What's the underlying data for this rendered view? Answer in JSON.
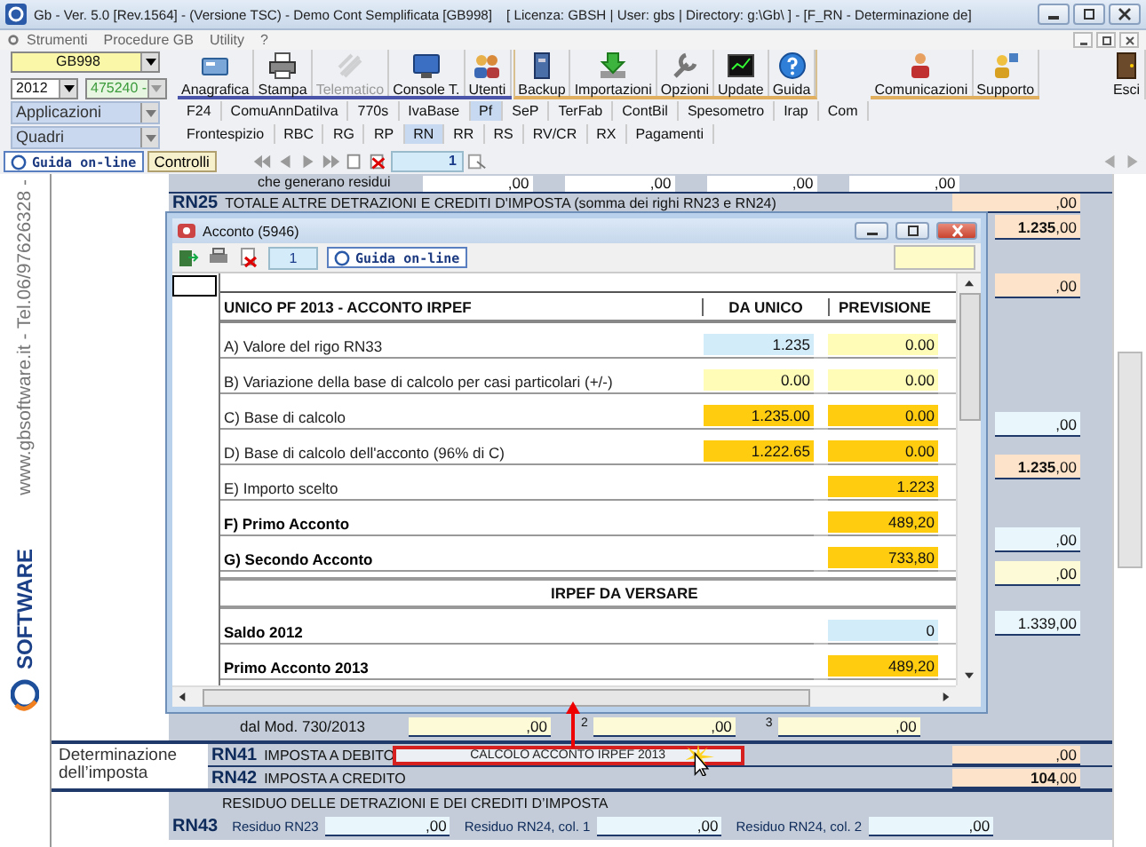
{
  "window": {
    "title": "Gb - Ver. 5.0 [Rev.1564] - (Versione TSC) -  Demo Cont Semplificata [GB998]",
    "info": "[ Licenza: GBSH | User: gbs | Directory: g:\\Gb\\ ] - [F_RN - Determinazione de]"
  },
  "menu": [
    "Strumenti",
    "Procedure GB",
    "Utility",
    "?"
  ],
  "selectors": {
    "company": "GB998",
    "year": "2012",
    "code": "475240 -",
    "applications": "Applicazioni",
    "sections": "Quadri"
  },
  "toolbar_main": [
    {
      "label": "Anagrafica",
      "disabled": false
    },
    {
      "label": "Stampa",
      "disabled": false
    },
    {
      "label": "Telematico",
      "disabled": true
    },
    {
      "label": "Console T.",
      "disabled": false
    },
    {
      "label": "Utenti",
      "disabled": false
    }
  ],
  "toolbar_tools": [
    {
      "label": "Backup"
    },
    {
      "label": "Importazioni"
    },
    {
      "label": "Opzioni"
    },
    {
      "label": "Update"
    },
    {
      "label": "Guida"
    }
  ],
  "toolbar_extra": [
    {
      "label": "Comunicazioni"
    },
    {
      "label": "Supporto"
    }
  ],
  "exit": "Esci",
  "app_tabs": [
    {
      "label": "F24",
      "selected": false
    },
    {
      "label": "ComuAnnDatiIva",
      "selected": false
    },
    {
      "label": "770s",
      "selected": false
    },
    {
      "label": "IvaBase",
      "selected": false
    },
    {
      "label": "Pf",
      "selected": true
    },
    {
      "label": "SeP",
      "selected": false
    },
    {
      "label": "TerFab",
      "selected": false
    },
    {
      "label": "ContBil",
      "selected": false
    },
    {
      "label": "Spesometro",
      "selected": false
    },
    {
      "label": "Irap",
      "selected": false
    },
    {
      "label": "Com",
      "selected": false
    }
  ],
  "quadro_tabs": [
    {
      "label": "Frontespizio",
      "selected": false
    },
    {
      "label": "RBC",
      "selected": false
    },
    {
      "label": "RG",
      "selected": false
    },
    {
      "label": "RP",
      "selected": false
    },
    {
      "label": "RN",
      "selected": true
    },
    {
      "label": "RR",
      "selected": false
    },
    {
      "label": "RS",
      "selected": false
    },
    {
      "label": "RV/CR",
      "selected": false
    },
    {
      "label": "RX",
      "selected": false
    },
    {
      "label": "Pagamenti",
      "selected": false
    }
  ],
  "nav": {
    "help": "Guida on-line",
    "checks": "Controlli",
    "page": "1"
  },
  "sidebar": {
    "contact": "www.gbsoftware.it - Tel.06/97626328 -",
    "logo": "SOFTWARE"
  },
  "form": {
    "residui_row": {
      "label": "che generano residui",
      "fields": [
        ",00",
        ",00",
        ",00",
        ",00"
      ]
    },
    "rn25": {
      "code": "RN25",
      "label": "TOTALE ALTRE DETRAZIONI E CREDITI D'IMPOSTA (somma dei righi RN23 e RN24)",
      "value": ",00"
    },
    "right_values": [
      {
        "value": "**1.235**,00",
        "kind": "calc"
      },
      {
        "value": ",00",
        "kind": "calc"
      },
      {
        "value": ",00",
        "kind": "input"
      },
      {
        "value": "**1.235**,00",
        "kind": "calc"
      },
      {
        "value": ",00",
        "kind": "input"
      },
      {
        "value": ",00",
        "kind": "manual"
      },
      {
        "value": "1.339,00",
        "kind": "input"
      }
    ],
    "rn40": {
      "label": "dal Mod. 730/2013",
      "fields": [
        {
          "value": ",00"
        },
        {
          "tag": "2",
          "value": ",00"
        },
        {
          "tag": "3",
          "value": ",00"
        }
      ]
    },
    "section_label": "Determinazione dell’imposta",
    "rn41": {
      "code": "RN41",
      "label": "IMPOSTA A DEBITO",
      "action": "CALCOLO ACCONTO IRPEF  2013",
      "value": ",00"
    },
    "rn42": {
      "code": "RN42",
      "label": "IMPOSTA A CREDITO",
      "value": "**104**,00"
    },
    "residuo_title": "RESIDUO DELLE DETRAZIONI E DEI CREDITI D’IMPOSTA",
    "rn43": {
      "code": "RN43",
      "fields": [
        {
          "label": "Residuo RN23",
          "value": ",00"
        },
        {
          "label": "Residuo RN24, col. 1",
          "value": ",00"
        },
        {
          "label": "Residuo RN24, col. 2",
          "value": ",00"
        }
      ]
    }
  },
  "dialog": {
    "title": "Acconto (5946)",
    "page": "1",
    "help": "Guida on-line",
    "header": [
      "UNICO PF 2013 - ACCONTO IRPEF",
      "DA UNICO",
      "PREVISIONE"
    ],
    "rows": [
      {
        "kind": "pair",
        "label": "A) Valore del rigo RN33",
        "bold": false,
        "unico": {
          "value": "1.235",
          "kind": "input"
        },
        "previsione": {
          "value": "0.00",
          "kind": "manual"
        }
      },
      {
        "kind": "pair",
        "label": "B) Variazione della base di calcolo per casi particolari (+/-)",
        "bold": false,
        "unico": {
          "value": "0.00",
          "kind": "manual"
        },
        "previsione": {
          "value": "0.00",
          "kind": "manual"
        }
      },
      {
        "kind": "pair",
        "label": "C) Base di calcolo",
        "bold": false,
        "unico": {
          "value": "1.235.00",
          "kind": "calc"
        },
        "previsione": {
          "value": "0.00",
          "kind": "calc"
        }
      },
      {
        "kind": "pair",
        "label": "D) Base di calcolo dell'acconto (96% di C)",
        "bold": false,
        "unico": {
          "value": "1.222.65",
          "kind": "calc"
        },
        "previsione": {
          "value": "0.00",
          "kind": "calc"
        }
      },
      {
        "kind": "single",
        "label": "E) Importo scelto",
        "bold": false,
        "previsione": {
          "value": "1.223",
          "kind": "calc"
        }
      },
      {
        "kind": "single",
        "label": "F) Primo Acconto",
        "bold": true,
        "previsione": {
          "value": "489,20",
          "kind": "calc"
        }
      },
      {
        "kind": "single",
        "label": "G) Secondo Acconto",
        "bold": true,
        "previsione": {
          "value": "733,80",
          "kind": "calc"
        }
      },
      {
        "kind": "section",
        "label": "IRPEF DA VERSARE"
      },
      {
        "kind": "single",
        "label": "Saldo 2012",
        "bold": true,
        "previsione": {
          "value": "0",
          "kind": "input"
        }
      },
      {
        "kind": "single",
        "label": "Primo Acconto 2013",
        "bold": true,
        "previsione": {
          "value": "489,20",
          "kind": "calc"
        }
      }
    ]
  }
}
